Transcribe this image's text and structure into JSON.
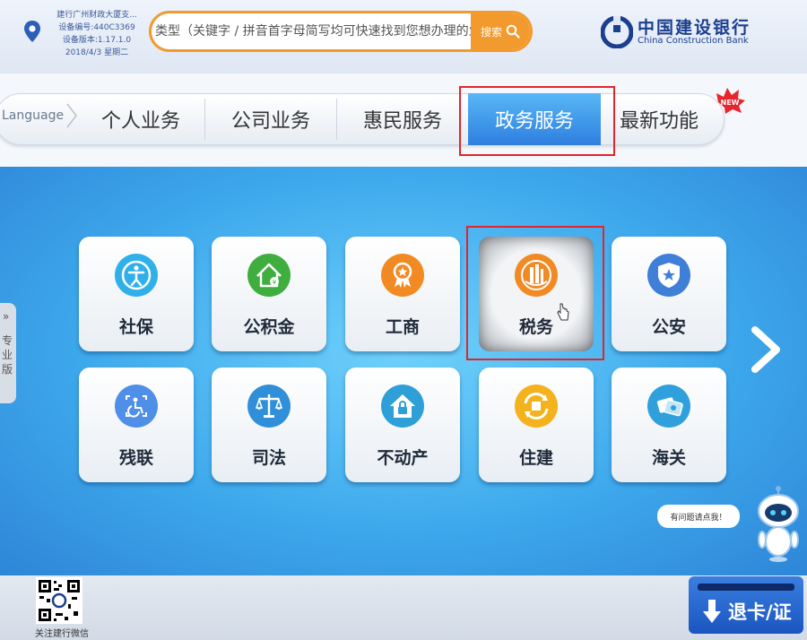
{
  "header": {
    "device_info": [
      "建行广州财政大厦支...",
      "设备编号:440C3369",
      "设备版本:1.17.1.0",
      "2018/4/3 星期二"
    ],
    "search": {
      "placeholder": "类型（关键字 / 拼音首字母简写均可快速找到您想办理的业",
      "button_label": "搜索"
    },
    "bank_name_cn": "中国建设银行",
    "bank_name_en": "China Construction Bank"
  },
  "nav": {
    "language_label": "Language",
    "tabs": [
      {
        "label": "个人业务",
        "active": false
      },
      {
        "label": "公司业务",
        "active": false
      },
      {
        "label": "惠民服务",
        "active": false
      },
      {
        "label": "政务服务",
        "active": true
      },
      {
        "label": "最新功能",
        "active": false
      }
    ],
    "new_badge": "NEW"
  },
  "services": [
    {
      "label": "社保",
      "icon": "person-icon"
    },
    {
      "label": "公积金",
      "icon": "house-fund-icon"
    },
    {
      "label": "工商",
      "icon": "award-icon"
    },
    {
      "label": "税务",
      "icon": "tax-building-icon"
    },
    {
      "label": "公安",
      "icon": "police-shield-icon"
    },
    {
      "label": "残联",
      "icon": "disability-icon"
    },
    {
      "label": "司法",
      "icon": "scales-icon"
    },
    {
      "label": "不动产",
      "icon": "house-lock-icon"
    },
    {
      "label": "住建",
      "icon": "construction-icon"
    },
    {
      "label": "海关",
      "icon": "customs-icon"
    }
  ],
  "side_panel": {
    "arrows": "»",
    "label": "专业版"
  },
  "help": {
    "bubble_text": "有问题请点我！"
  },
  "footer": {
    "qr_label": "关注建行微信",
    "exit_label": "退卡/证"
  },
  "colors": {
    "accent_orange": "#f29a2e",
    "active_tab": "#2f7fe0",
    "highlight_frame": "#e0262c",
    "brand_blue": "#1b3f8f"
  }
}
